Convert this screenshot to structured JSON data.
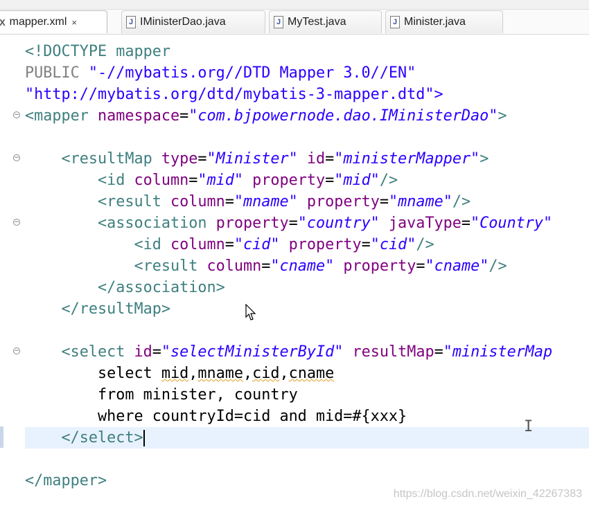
{
  "tabs": [
    {
      "label": "mapper.xml",
      "active": true,
      "icon": "xml-file-icon",
      "icon_glyph": "X",
      "close": "×"
    },
    {
      "label": "IMinisterDao.java",
      "active": false,
      "icon": "java-file-icon",
      "icon_glyph": "J"
    },
    {
      "label": "MyTest.java",
      "active": false,
      "icon": "java-file-icon",
      "icon_glyph": "J"
    },
    {
      "label": "Minister.java",
      "active": false,
      "icon": "java-file-icon",
      "icon_glyph": "J"
    }
  ],
  "code": {
    "doctype": "<!DOCTYPE mapper",
    "public_kw": "PUBLIC ",
    "public_id": "\"-//mybatis.org//DTD Mapper 3.0//EN\"",
    "system_id": "\"http://mybatis.org/dtd/mybatis-3-mapper.dtd\">",
    "mapper_open": "<mapper",
    "namespace_attr": " namespace",
    "namespace_value": "\"com.bjpowernode.dao.IMinisterDao\"",
    "resultmap_open": "<resultMap",
    "type_attr": " type",
    "type_value": "\"Minister\"",
    "id_attr": " id",
    "resultmap_id_value": "\"ministerMapper\"",
    "id_tag": "<id",
    "column_attr": " column",
    "mid_value": "\"mid\"",
    "property_attr": " property",
    "result_tag": "<result",
    "mname_value": "\"mname\"",
    "association_tag": "<association",
    "country_value": "\"country\"",
    "javatype_attr": " javaType",
    "javatype_value": "\"Country\"",
    "cid_value": "\"cid\"",
    "cname_value": "\"cname\"",
    "association_close": "</association>",
    "resultmap_close": "</resultMap>",
    "select_tag": "<select",
    "select_id_value": "\"selectMinisterById\"",
    "resultmap_attr": " resultMap",
    "select_resultmap_value": "\"ministerMap",
    "sql_select_kw": "select ",
    "sql_columns": [
      "mid",
      "mname",
      "cid",
      "cname"
    ],
    "sql_from": "from minister, country",
    "sql_where": "where countryId=cid and mid=#{xxx}",
    "select_close": "</select>",
    "mapper_close": "</mapper>"
  },
  "watermark": "https://blog.csdn.net/weixin_42267383",
  "colors": {
    "tag": "#3f7f7f",
    "attribute": "#7f007f",
    "value": "#2a00ff",
    "current_line": "#e8f2fe"
  }
}
